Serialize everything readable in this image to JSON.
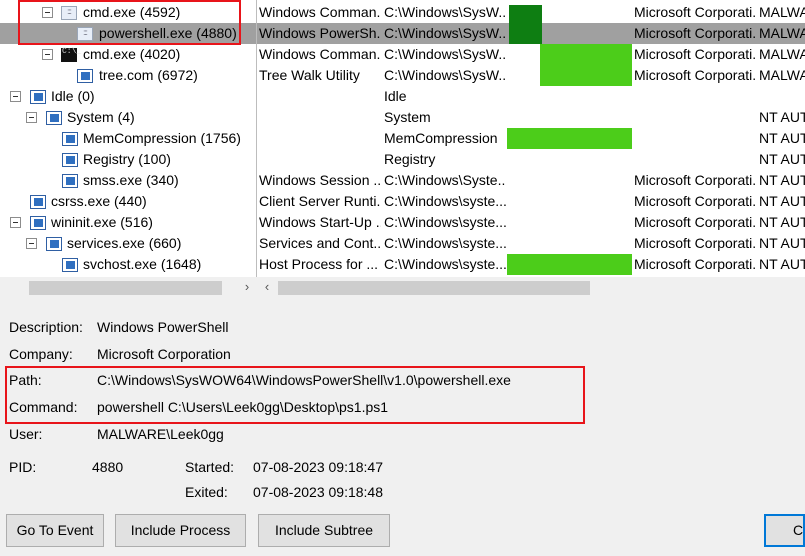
{
  "tree": [
    {
      "label": "cmd.exe (4592)",
      "icon": "console-dots-icon",
      "expander": true
    },
    {
      "label": "powershell.exe (4880)",
      "icon": "console-dots-icon",
      "expander": false
    },
    {
      "label": "cmd.exe (4020)",
      "icon": "cmd-console-icon",
      "expander": true
    },
    {
      "label": "tree.com (6972)",
      "icon": "window-icon",
      "expander": false
    },
    {
      "label": "Idle (0)",
      "icon": "window-icon",
      "expander": true
    },
    {
      "label": "System (4)",
      "icon": "window-icon",
      "expander": true
    },
    {
      "label": "MemCompression (1756)",
      "icon": "window-icon",
      "expander": false
    },
    {
      "label": "Registry (100)",
      "icon": "window-icon",
      "expander": false
    },
    {
      "label": "smss.exe (340)",
      "icon": "window-icon",
      "expander": false
    },
    {
      "label": "csrss.exe (440)",
      "icon": "window-icon",
      "expander": false
    },
    {
      "label": "wininit.exe (516)",
      "icon": "window-icon",
      "expander": true
    },
    {
      "label": "services.exe (660)",
      "icon": "window-icon",
      "expander": true
    },
    {
      "label": "svchost.exe (1648)",
      "icon": "window-icon",
      "expander": false
    }
  ],
  "rows": [
    {
      "description": "Windows Comman...",
      "path": "C:\\Windows\\SysW...",
      "company": "Microsoft Corporati...",
      "user": "MALWA"
    },
    {
      "description": "Windows PowerSh...",
      "path": "C:\\Windows\\SysW...",
      "company": "Microsoft Corporati...",
      "user": "MALWA"
    },
    {
      "description": "Windows Comman...",
      "path": "C:\\Windows\\SysW...",
      "company": "Microsoft Corporati...",
      "user": "MALWA"
    },
    {
      "description": "Tree Walk Utility",
      "path": "C:\\Windows\\SysW...",
      "company": "Microsoft Corporati...",
      "user": "MALWA"
    },
    {
      "description": "",
      "path": "Idle",
      "company": "",
      "user": ""
    },
    {
      "description": "",
      "path": "System",
      "company": "",
      "user": "NT AUT"
    },
    {
      "description": "",
      "path": "MemCompression",
      "company": "",
      "user": "NT AUT"
    },
    {
      "description": "",
      "path": "Registry",
      "company": "",
      "user": "NT AUT"
    },
    {
      "description": "Windows Session ...",
      "path": "C:\\Windows\\Syste...",
      "company": "Microsoft Corporati...",
      "user": "NT AUT"
    },
    {
      "description": "Client Server Runti...",
      "path": "C:\\Windows\\syste...",
      "company": "Microsoft Corporati...",
      "user": "NT AUT"
    },
    {
      "description": "Windows Start-Up ...",
      "path": "C:\\Windows\\syste...",
      "company": "Microsoft Corporati...",
      "user": "NT AUT"
    },
    {
      "description": "Services and Cont...",
      "path": "C:\\Windows\\syste...",
      "company": "Microsoft Corporati...",
      "user": "NT AUT"
    },
    {
      "description": "Host Process for ...",
      "path": "C:\\Windows\\syste...",
      "company": "Microsoft Corporati...",
      "user": "NT AUT"
    }
  ],
  "details": {
    "description_label": "Description:",
    "description": "Windows PowerShell",
    "company_label": "Company:",
    "company": "Microsoft Corporation",
    "path_label": "Path:",
    "path": "C:\\Windows\\SysWOW64\\WindowsPowerShell\\v1.0\\powershell.exe",
    "command_label": "Command:",
    "command": "powershell  C:\\Users\\Leek0gg\\Desktop\\ps1.ps1",
    "user_label": "User:",
    "user": "MALWARE\\Leek0gg",
    "pid_label": "PID:",
    "pid": "4880",
    "started_label": "Started:",
    "started": "07-08-2023 09:18:47",
    "exited_label": "Exited:",
    "exited": "07-08-2023 09:18:48"
  },
  "buttons": {
    "go_to_event": "Go To Event",
    "include_process": "Include Process",
    "include_subtree": "Include Subtree",
    "partial": "C"
  },
  "scroll": {
    "left_arrow": "‹",
    "right_arrow": "›"
  },
  "colors": {
    "highlight_red": "#e8141a",
    "cpu_green": "#4ccd1a",
    "cpu_green_dark": "#0e7e12",
    "selected_row": "#a0a0a0",
    "accent": "#0078d7"
  }
}
